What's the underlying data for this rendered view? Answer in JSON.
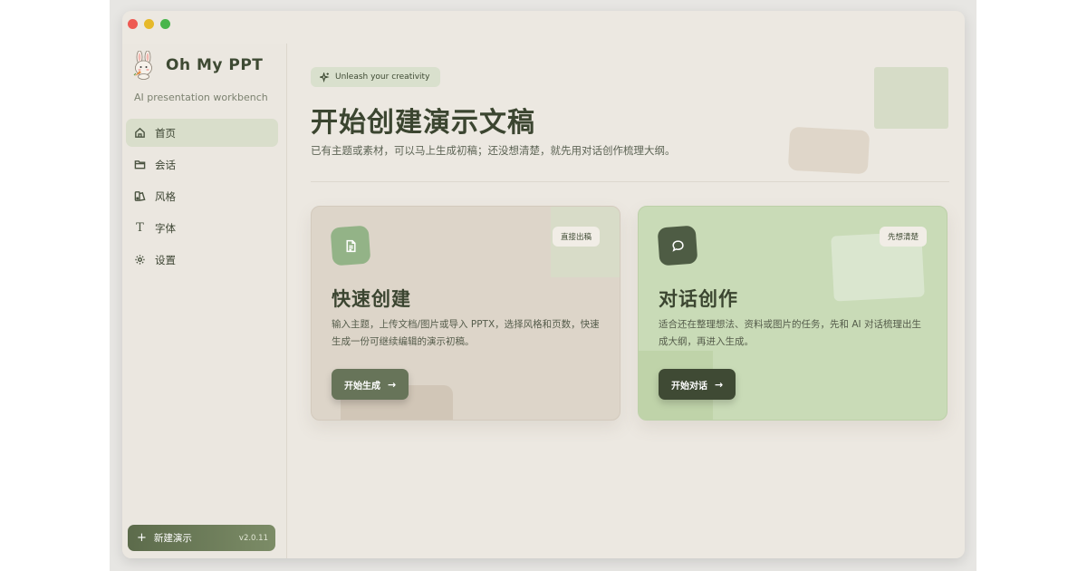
{
  "app": {
    "name": "Oh My PPT",
    "subtitle": "AI presentation workbench",
    "version": "v2.0.11"
  },
  "sidebar": {
    "items": [
      {
        "label": "首页",
        "icon": "home-icon",
        "active": true
      },
      {
        "label": "会话",
        "icon": "folder-icon",
        "active": false
      },
      {
        "label": "风格",
        "icon": "palette-icon",
        "active": false
      },
      {
        "label": "字体",
        "icon": "type-icon",
        "active": false
      },
      {
        "label": "设置",
        "icon": "gear-icon",
        "active": false
      }
    ],
    "new_button": "新建演示"
  },
  "hero": {
    "pill": "Unleash your creativity",
    "title": "开始创建演示文稿",
    "subtitle": "已有主题或素材，可以马上生成初稿；还没想清楚，就先用对话创作梳理大纲。"
  },
  "cards": [
    {
      "tag": "直接出稿",
      "title": "快速创建",
      "desc": "输入主题，上传文档/图片或导入 PPTX，选择风格和页数，快速生成一份可继续编辑的演示初稿。",
      "button": "开始生成",
      "icon": "document-icon"
    },
    {
      "tag": "先想清楚",
      "title": "对话创作",
      "desc": "适合还在整理想法、资料或图片的任务，先和 AI 对话梳理出生成大纲，再进入生成。",
      "button": "开始对话",
      "icon": "chat-bubble-icon"
    }
  ],
  "colors": {
    "accent": "#5c6b4b",
    "sidebar_active": "#d9decb",
    "card_left_bg": "#ddd5c9",
    "card_right_bg": "#c9dbb7"
  }
}
